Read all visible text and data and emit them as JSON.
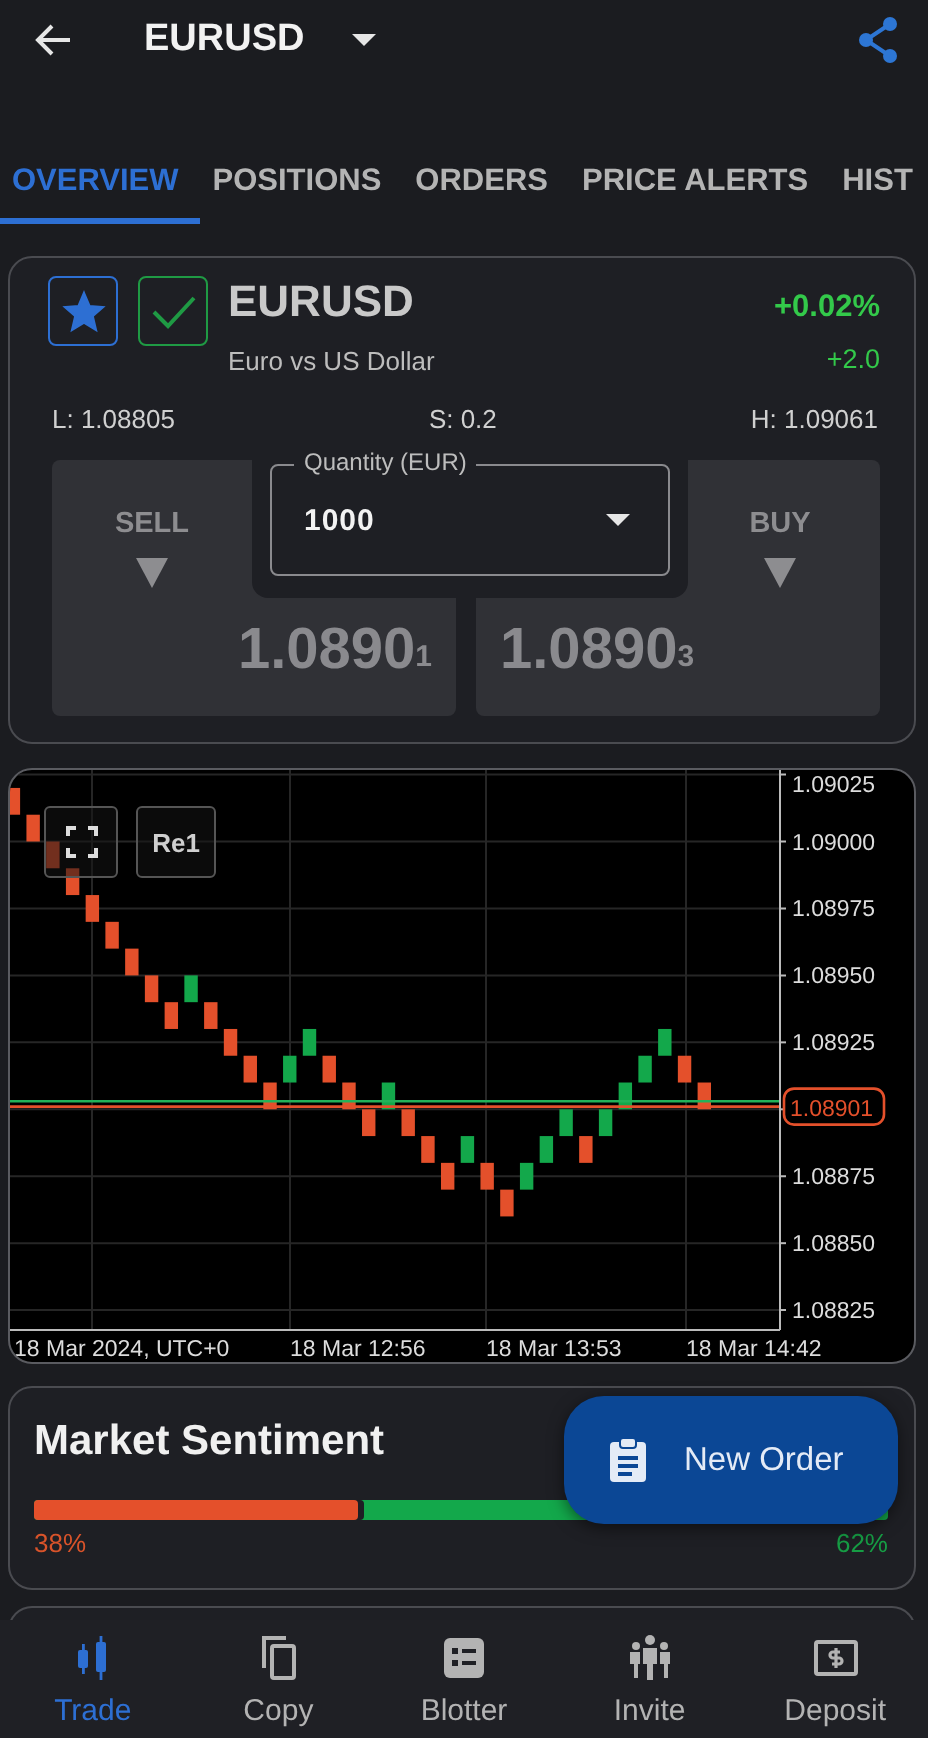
{
  "header": {
    "title": "EURUSD"
  },
  "tabs": [
    {
      "label": "OVERVIEW",
      "selected": true
    },
    {
      "label": "POSITIONS",
      "selected": false
    },
    {
      "label": "ORDERS",
      "selected": false
    },
    {
      "label": "PRICE ALERTS",
      "selected": false
    },
    {
      "label": "HIST",
      "selected": false
    }
  ],
  "instrument": {
    "favorite": true,
    "watch_enabled": true,
    "symbol": "EURUSD",
    "description": "Euro vs US Dollar",
    "change_percent": "+0.02%",
    "change_points": "+2.0",
    "low": "L: 1.08805",
    "spread": "S: 0.2",
    "high": "H: 1.09061"
  },
  "trade": {
    "sell": {
      "label": "SELL",
      "price": "1.0890$_{1}$"
    },
    "buy": {
      "label": "BUY",
      "price": "1.0890$_{3}$"
    },
    "quantity": {
      "label": "Quantity (EUR)",
      "value": "1000"
    }
  },
  "chart": {
    "buttons": [
      {
        "kind": "fullscreen"
      },
      {
        "kind": "text",
        "label": "Re1"
      }
    ],
    "y_axis_labels": [
      {
        "kind": "tick",
        "label": "1.09025"
      },
      {
        "kind": "tick",
        "label": "1.09000"
      },
      {
        "kind": "tick",
        "label": "1.08975"
      },
      {
        "kind": "tick",
        "label": "1.08950"
      },
      {
        "kind": "tick",
        "label": "1.08925"
      },
      {
        "kind": "price",
        "label": "1.08901"
      },
      {
        "kind": "tick",
        "label": "1.08875"
      },
      {
        "kind": "tick",
        "label": "1.08850"
      },
      {
        "kind": "tick",
        "label": "1.08825"
      }
    ],
    "x_axis_labels": [
      "18 Mar 2024, UTC+0",
      "18 Mar 12:56",
      "18 Mar 13:53",
      "18 Mar 14:42"
    ]
  },
  "sentiment": {
    "title": "Market Sentiment",
    "level": 0.38,
    "sell_label": "38%",
    "buy_label": "62%"
  },
  "fab": {
    "label": "New Order"
  },
  "nav": [
    {
      "kind": "trade",
      "label": "Trade",
      "selected": true
    },
    {
      "kind": "copy",
      "label": "Copy",
      "selected": false
    },
    {
      "kind": "blotter",
      "label": "Blotter",
      "selected": false
    },
    {
      "kind": "invite",
      "label": "Invite",
      "selected": false
    },
    {
      "kind": "deposit",
      "label": "Deposit",
      "selected": false
    }
  ]
}
